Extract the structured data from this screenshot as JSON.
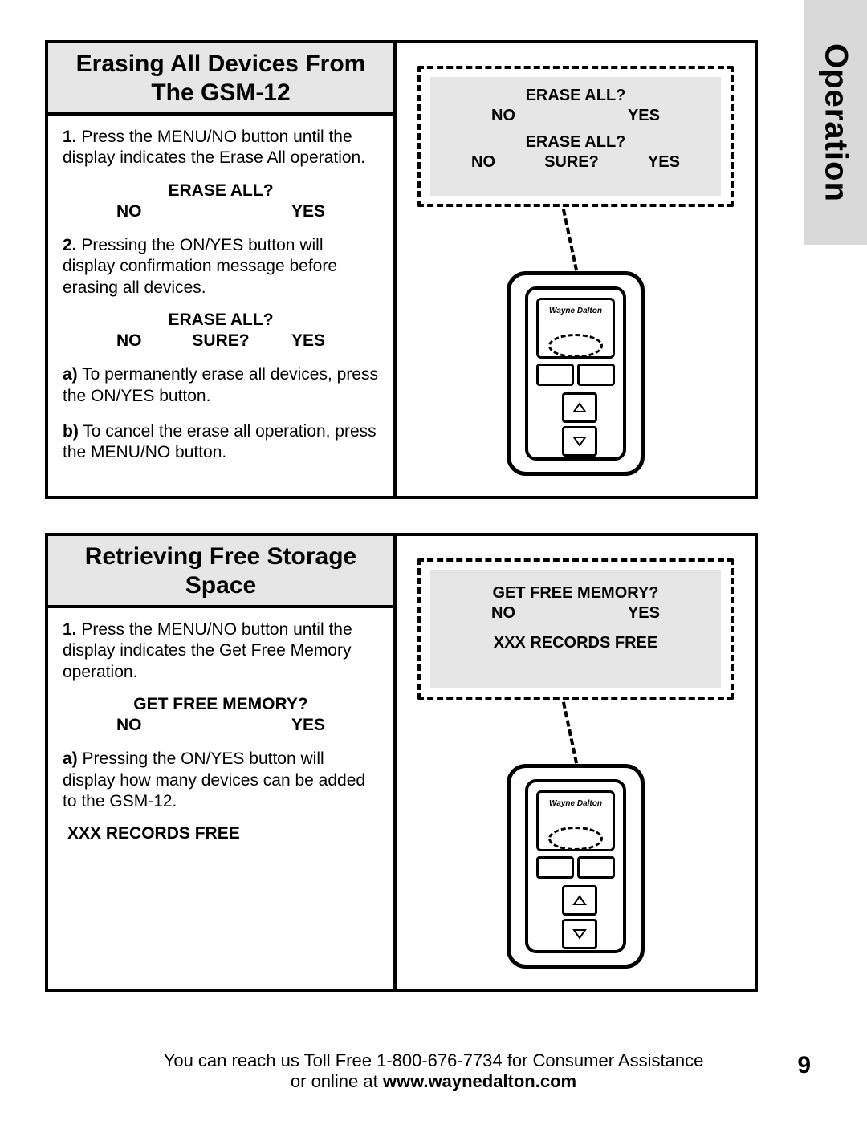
{
  "side_tab": "Operation",
  "section1": {
    "title": "Erasing All Devices From The GSM-12",
    "step1_num": "1.",
    "step1_text": " Press the MENU/NO button until the display indicates the Erase All operation.",
    "lcd1_line1": "ERASE ALL?",
    "lcd1_no": "NO",
    "lcd1_yes": "YES",
    "step2_num": "2.",
    "step2_text": " Pressing the ON/YES button will display confirmation message before erasing all devices.",
    "lcd2_line1": "ERASE ALL?",
    "lcd2_no": "NO",
    "lcd2_mid": "SURE?",
    "lcd2_yes": "YES",
    "a_num": "a)",
    "a_text": " To permanently erase all devices, press the ON/YES button.",
    "b_num": "b)",
    "b_text": " To cancel the erase all operation, press the MENU/NO button.",
    "callout": {
      "l1": "ERASE ALL?",
      "l1_no": "NO",
      "l1_yes": "YES",
      "l2": "ERASE ALL?",
      "l2_no": "NO",
      "l2_mid": "SURE?",
      "l2_yes": "YES"
    }
  },
  "section2": {
    "title": "Retrieving Free Storage Space",
    "step1_num": "1.",
    "step1_text": " Press the MENU/NO button until the display indicates the Get Free Memory operation.",
    "lcd1_line1": "GET FREE MEMORY?",
    "lcd1_no": "NO",
    "lcd1_yes": "YES",
    "a_num": "a)",
    "a_text": " Pressing the ON/YES button will display how many devices can be added to the GSM-12.",
    "lcd2": "XXX RECORDS FREE",
    "callout": {
      "l1": "GET FREE MEMORY?",
      "l1_no": "NO",
      "l1_yes": "YES",
      "l2": "XXX RECORDS FREE"
    }
  },
  "footer": {
    "line1": "You can reach us Toll Free 1-800-676-7734 for Consumer Assistance",
    "line2_pre": "or online at ",
    "line2_url": "www.waynedalton.com",
    "page": "9"
  },
  "device_brand": "Wayne Dalton"
}
